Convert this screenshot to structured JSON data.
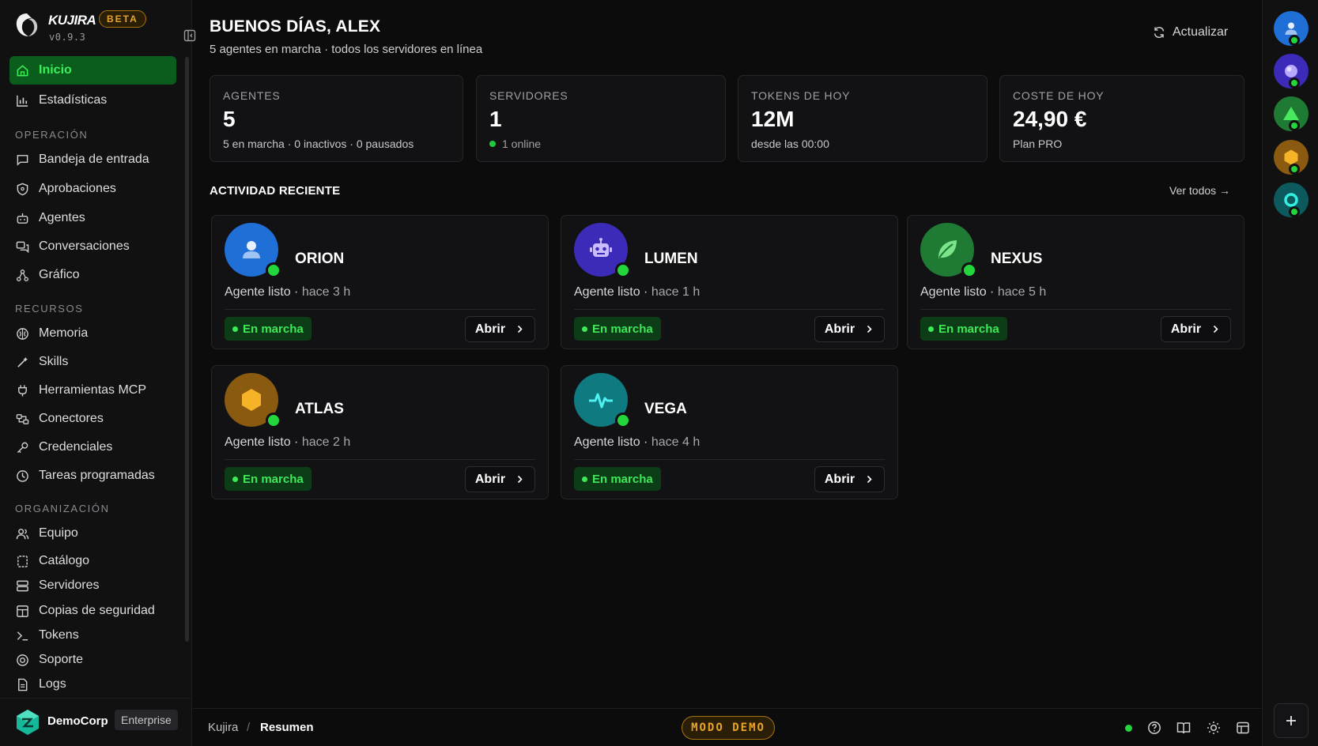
{
  "app": {
    "name": "KUJIRA",
    "badge": "BETA",
    "version": "v0.9.3"
  },
  "sidebar": {
    "main_items": [
      {
        "label": "Inicio",
        "icon": "home-icon",
        "active": true
      },
      {
        "label": "Estadísticas",
        "icon": "bar-chart-icon"
      }
    ],
    "sections": [
      {
        "title": "OPERACIÓN",
        "items": [
          {
            "label": "Bandeja de entrada",
            "icon": "inbox-icon"
          },
          {
            "label": "Aprobaciones",
            "icon": "shield-icon"
          },
          {
            "label": "Agentes",
            "icon": "bot-icon"
          },
          {
            "label": "Conversaciones",
            "icon": "messages-icon"
          },
          {
            "label": "Gráfico",
            "icon": "graph-icon"
          }
        ]
      },
      {
        "title": "RECURSOS",
        "items": [
          {
            "label": "Memoria",
            "icon": "brain-icon"
          },
          {
            "label": "Skills",
            "icon": "wand-icon"
          },
          {
            "label": "Herramientas MCP",
            "icon": "plug-icon"
          },
          {
            "label": "Conectores",
            "icon": "link-icon"
          },
          {
            "label": "Credenciales",
            "icon": "key-icon"
          },
          {
            "label": "Tareas programadas",
            "icon": "clock-icon"
          }
        ]
      },
      {
        "title": "ORGANIZACIÓN",
        "items": [
          {
            "label": "Equipo",
            "icon": "users-icon"
          },
          {
            "label": "Catálogo",
            "icon": "catalog-icon"
          },
          {
            "label": "Servidores",
            "icon": "server-icon"
          },
          {
            "label": "Copias de seguridad",
            "icon": "database-icon"
          },
          {
            "label": "Tokens",
            "icon": "terminal-icon"
          },
          {
            "label": "Soporte",
            "icon": "lifebuoy-icon"
          },
          {
            "label": "Logs",
            "icon": "file-icon"
          }
        ]
      }
    ],
    "org": {
      "name": "DemoCorp",
      "plan": "Enterprise"
    }
  },
  "header": {
    "greeting": "BUENOS DÍAS, ALEX",
    "subtitle": "5 agentes en marcha · todos los servidores en línea",
    "refresh_label": "Actualizar"
  },
  "stats": [
    {
      "label": "AGENTES",
      "value": "5",
      "sub": "5 en marcha · 0 inactivos · 0 pausados",
      "dot": false
    },
    {
      "label": "SERVIDORES",
      "value": "1",
      "sub": "1 online",
      "dot": true
    },
    {
      "label": "TOKENS DE HOY",
      "value": "12M",
      "sub": "desde las 00:00",
      "dot": false
    },
    {
      "label": "COSTE DE HOY",
      "value": "24,90 €",
      "sub": "Plan PRO",
      "dot": false
    }
  ],
  "activity": {
    "title": "ACTIVIDAD RECIENTE",
    "see_all": "Ver todos →",
    "agents": [
      {
        "name": "ORION",
        "status": "Agente listo",
        "time": "hace 3 h",
        "badge": "En marcha",
        "action": "Abrir",
        "icon": "user-icon",
        "color": "#1f6fd6"
      },
      {
        "name": "LUMEN",
        "status": "Agente listo",
        "time": "hace 1 h",
        "badge": "En marcha",
        "action": "Abrir",
        "icon": "robot-icon",
        "color": "#3b2bb8"
      },
      {
        "name": "NEXUS",
        "status": "Agente listo",
        "time": "hace 5 h",
        "badge": "En marcha",
        "action": "Abrir",
        "icon": "leaf-icon",
        "color": "#1f7a33"
      },
      {
        "name": "ATLAS",
        "status": "Agente listo",
        "time": "hace 2 h",
        "badge": "En marcha",
        "action": "Abrir",
        "icon": "hexagon-icon",
        "color": "#8a5a10"
      },
      {
        "name": "VEGA",
        "status": "Agente listo",
        "time": "hace 4 h",
        "badge": "En marcha",
        "action": "Abrir",
        "icon": "pulse-icon",
        "color": "#0f7a80"
      }
    ]
  },
  "bottom_bar": {
    "breadcrumb_root": "Kujira",
    "breadcrumb_sep": "/",
    "breadcrumb_current": "Resumen",
    "demo_badge": "MODO DEMO"
  },
  "rail": {
    "add_label": "+"
  },
  "colors": {
    "accent_green": "#22d63c",
    "active_nav_bg": "#0b5d1e",
    "beta_amber": "#e8a52a"
  }
}
